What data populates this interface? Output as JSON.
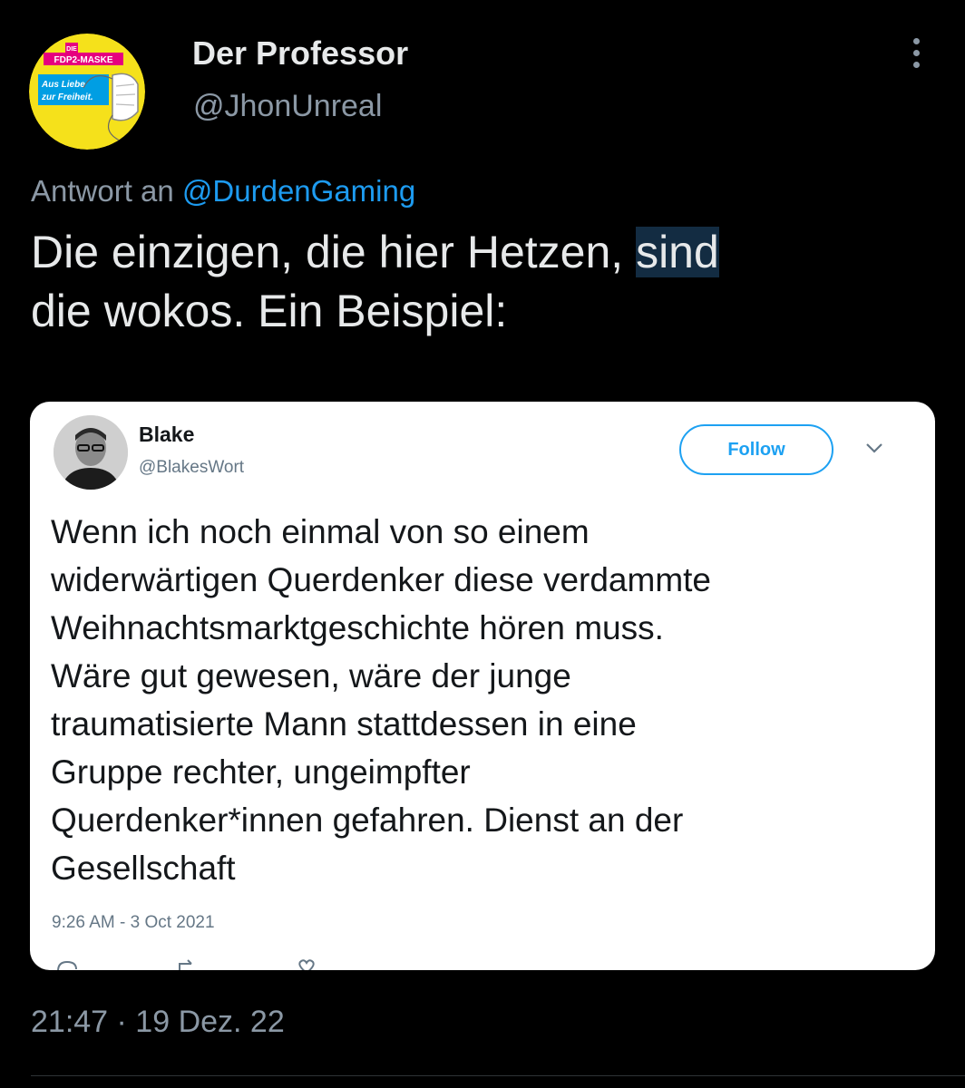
{
  "author": {
    "display_name": "Der Professor",
    "handle": "@JhonUnreal",
    "avatar_badge_lines": [
      "DIE",
      "FDP2-MASKE",
      "Aus Liebe",
      "zur Freiheit."
    ]
  },
  "reply": {
    "prefix": "Antwort an",
    "mention": "@DurdenGaming"
  },
  "tweet": {
    "line1_before": "Die einzigen, die hier Hetzen,",
    "line1_highlight": "sind",
    "line2": "die wokos. Ein Beispiel:"
  },
  "embedded_tweet": {
    "name": "Blake",
    "handle": "@BlakesWort",
    "follow_label": "Follow",
    "text_lines": [
      "Wenn ich noch einmal von so einem",
      "widerwärtigen Querdenker diese verdammte",
      "Weihnachtsmarktgeschichte hören muss.",
      "Wäre gut gewesen, wäre der junge",
      "traumatisierte Mann stattdessen in eine",
      "Gruppe rechter, ungeimpfter",
      "Querdenker*innen gefahren. Dienst an der",
      "Gesellschaft"
    ],
    "timestamp": "9:26 AM - 3 Oct 2021"
  },
  "footer": {
    "timestamp": "21:47 · 19 Dez. 22"
  },
  "colors": {
    "background": "#000000",
    "link": "#1d9bf0",
    "muted": "#8b98a5",
    "highlight": "#132c42",
    "badge_yellow": "#f5e11b",
    "badge_magenta": "#e6007e",
    "badge_cyan": "#009ee3"
  }
}
